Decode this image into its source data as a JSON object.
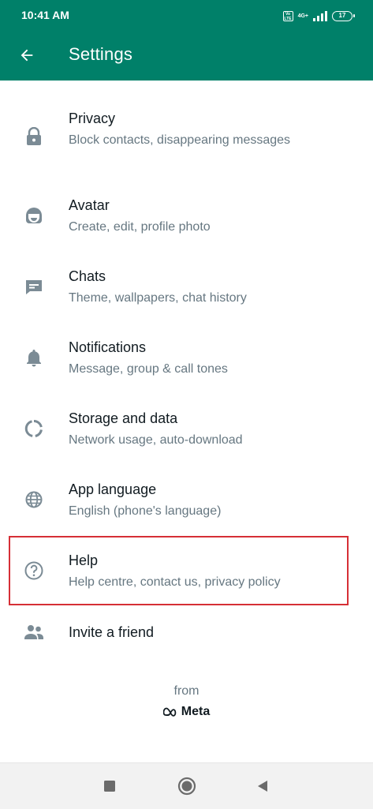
{
  "status_bar": {
    "time": "10:41 AM",
    "volte_badge": "Vo LTE",
    "network": "4G+",
    "battery": "17"
  },
  "header": {
    "title": "Settings",
    "back_icon": "arrow-left-icon",
    "background_color": "#008069"
  },
  "settings_items": [
    {
      "title": "Privacy",
      "subtitle": "Block contacts, disappearing messages",
      "icon": "lock-icon"
    },
    {
      "title": "Avatar",
      "subtitle": "Create, edit, profile photo",
      "icon": "avatar-face-icon"
    },
    {
      "title": "Chats",
      "subtitle": "Theme, wallpapers, chat history",
      "icon": "chat-icon"
    },
    {
      "title": "Notifications",
      "subtitle": "Message, group & call tones",
      "icon": "bell-icon"
    },
    {
      "title": "Storage and data",
      "subtitle": "Network usage, auto-download",
      "icon": "storage-circle-icon"
    },
    {
      "title": "App language",
      "subtitle": "English (phone's language)",
      "icon": "globe-icon"
    },
    {
      "title": "Help",
      "subtitle": "Help centre, contact us, privacy policy",
      "icon": "help-circle-icon",
      "highlighted": true
    },
    {
      "title": "Invite a friend",
      "subtitle": "",
      "icon": "people-icon"
    }
  ],
  "footer": {
    "from_label": "from",
    "brand": "Meta"
  },
  "highlight_color": "#d62f36",
  "nav_bar": {
    "recents_icon": "square-icon",
    "home_icon": "circle-home-icon",
    "back_icon": "triangle-back-icon"
  }
}
